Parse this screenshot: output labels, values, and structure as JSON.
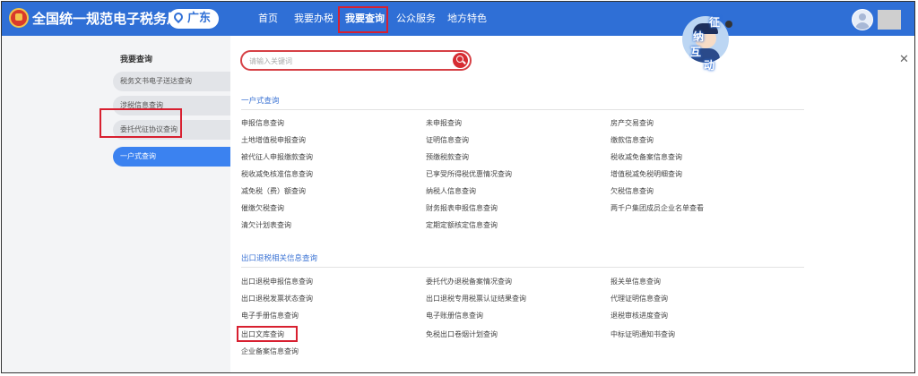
{
  "header": {
    "site_title": "全国统一规范电子税务局",
    "region": "广东",
    "nav": [
      "首页",
      "我要办税",
      "我要查询",
      "公众服务",
      "地方特色"
    ],
    "active_nav": "我要查询"
  },
  "mascot": {
    "chars": [
      "征",
      "纳",
      "互",
      "动"
    ]
  },
  "sidebar": {
    "title": "我要查询",
    "items": [
      {
        "label": "税务文书电子送达查询"
      },
      {
        "label": "涉税信息查询"
      },
      {
        "label": "委托代征协议查询"
      },
      {
        "label": "一户式查询",
        "active": true
      }
    ]
  },
  "search": {
    "placeholder": "请输入关键词"
  },
  "sections": [
    {
      "title": "一户式查询",
      "columns": [
        [
          "申报信息查询",
          "土地增值税申报查询",
          "被代征人申报缴款查询",
          "税收减免核准信息查询",
          "减免税（费）额查询",
          "催缴欠税查询",
          "清欠计划表查询"
        ],
        [
          "未申报查询",
          "证明信息查询",
          "预缴税款查询",
          "已享受所得税优惠情况查询",
          "纳税人信息查询",
          "财务报表申报信息查询",
          "定期定额核定信息查询"
        ],
        [
          "房产交易查询",
          "缴款信息查询",
          "税收减免备案信息查询",
          "增值税减免税明细查询",
          "欠税信息查询",
          "两千户集团成员企业名单查看"
        ]
      ]
    },
    {
      "title": "出口退税相关信息查询",
      "columns": [
        [
          "出口退税申报信息查询",
          "出口退税发票状态查询",
          "电子手册信息查询",
          "出口文库查询",
          "企业备案信息查询"
        ],
        [
          "委托代办退税备案情况查询",
          "出口退税专用税票认证结果查询",
          "电子账册信息查询",
          "免税出口卷烟计划查询"
        ],
        [
          "报关单信息查询",
          "代理证明信息查询",
          "退税审核进度查询",
          "中标证明通知书查询"
        ]
      ]
    }
  ]
}
